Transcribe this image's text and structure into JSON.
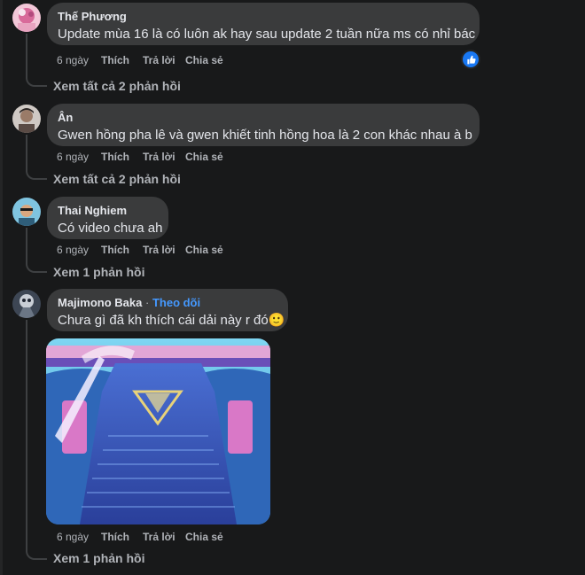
{
  "comments": [
    {
      "author": "Thế Phương",
      "text": "Update mùa 16 là có luôn ak hay sau update 2 tuần nữa ms có nhỉ bác",
      "time": "6 ngày",
      "like": "Thích",
      "reply": "Trả lời",
      "share": "Chia sẻ",
      "view_replies": "Xem tất cả 2 phản hồi",
      "reaction_icon": "like-icon"
    },
    {
      "author": "Ân",
      "text": "Gwen hồng pha lê và gwen khiết tinh hồng hoa là 2 con khác nhau à b",
      "time": "6 ngày",
      "like": "Thích",
      "reply": "Trả lời",
      "share": "Chia sẻ",
      "view_replies": "Xem tất cả 2 phản hồi"
    },
    {
      "author": "Thai Nghiem",
      "text": "Có video chưa ah",
      "time": "6 ngày",
      "like": "Thích",
      "reply": "Trả lời",
      "share": "Chia sẻ",
      "view_replies": "Xem 1 phản hồi"
    },
    {
      "author": "Majimono Baka",
      "separator": "·",
      "follow": "Theo dõi",
      "text": "Chưa gì đã kh thích cái dải này r đó",
      "emoji": "🙂",
      "time": "6 ngày",
      "like": "Thích",
      "reply": "Trả lời",
      "share": "Chia sẻ",
      "view_replies": "Xem 1 phản hồi"
    }
  ],
  "colors": {
    "background": "#18191a",
    "bubble": "#3a3b3c",
    "primary_text": "#e4e6eb",
    "secondary_text": "#b0b3b8",
    "link": "#4599ff",
    "like_badge": "#1877f2"
  }
}
